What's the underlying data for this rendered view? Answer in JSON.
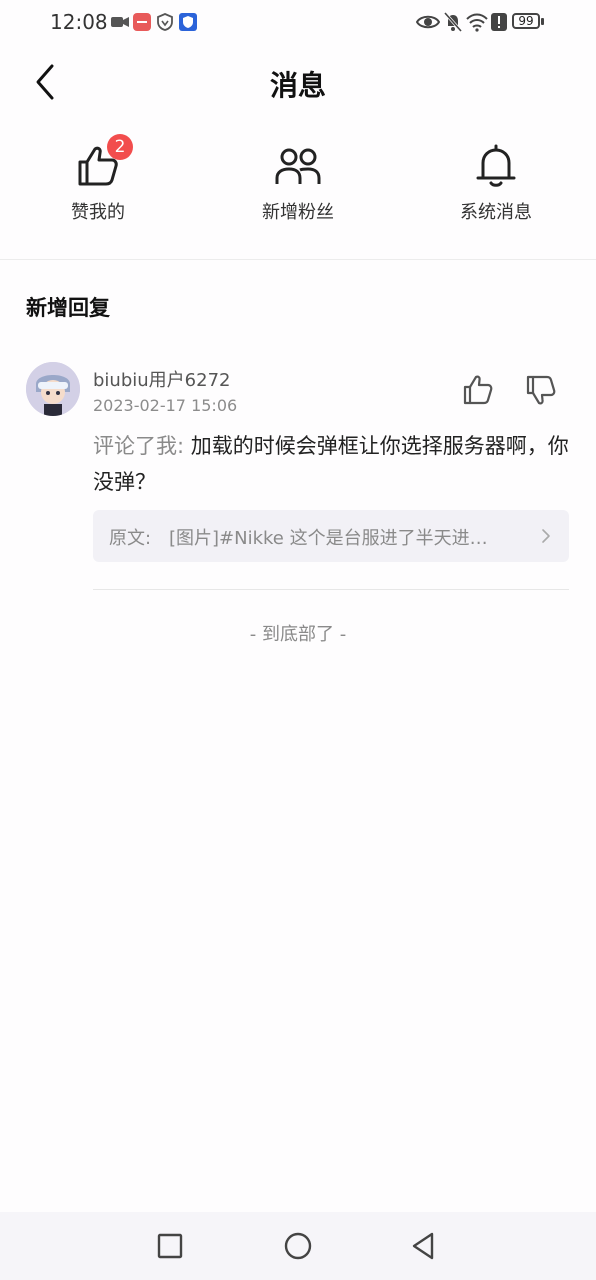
{
  "status_bar": {
    "time": "12:08",
    "battery": "99",
    "icons_left": [
      "video-camera-icon",
      "app-notification-icon",
      "vpn-shield-icon",
      "security-shield-icon"
    ],
    "icons_right": [
      "eye-icon",
      "mute-bell-icon",
      "wifi-icon",
      "alert-icon",
      "battery-icon"
    ]
  },
  "header": {
    "title": "消息",
    "back_icon": "chevron-left-icon"
  },
  "categories": [
    {
      "label": "赞我的",
      "icon": "thumbs-up-icon",
      "badge": "2"
    },
    {
      "label": "新增粉丝",
      "icon": "users-icon"
    },
    {
      "label": "系统消息",
      "icon": "bell-icon"
    }
  ],
  "section": {
    "title": "新增回复"
  },
  "reply": {
    "username": "biubiu用户6272",
    "timestamp": "2023-02-17 15:06",
    "prefix": "评论了我:",
    "content": "加载的时候会弹框让你选择服务器啊，你没弹？",
    "origin_label": "原文:",
    "origin_text": "[图片]#Nikke 这个是台服进了半天进…"
  },
  "footer": {
    "end_text": "- 到底部了 -"
  },
  "colors": {
    "badge": "#f24d4d",
    "background": "#fefdfe",
    "secondary_text": "#8a8a8a"
  }
}
